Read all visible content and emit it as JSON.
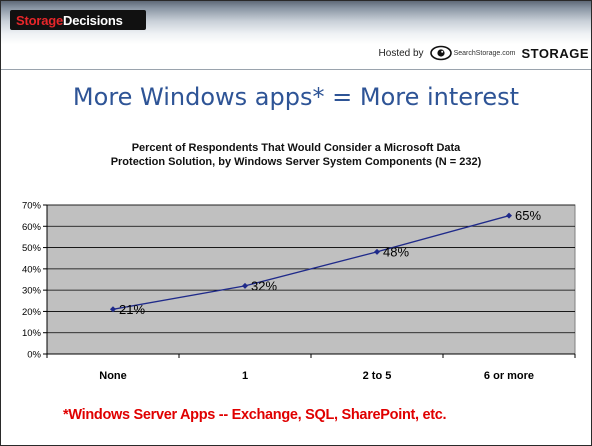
{
  "header": {
    "brand_part1": "Storage",
    "brand_part2": " Decisions",
    "hosted_by": "Hosted by",
    "site_logo_text": "SearchStorage.com",
    "storage_word": "STORAGE"
  },
  "slide": {
    "title": "More Windows apps* = More interest",
    "footnote": "*Windows Server Apps -- Exchange, SQL, SharePoint, etc."
  },
  "chart_data": {
    "type": "line",
    "title_line1": "Percent of Respondents That Would Consider a Microsoft Data",
    "title_line2": "Protection Solution, by Windows Server System Components (N = 232)",
    "categories": [
      "None",
      "1",
      "2 to 5",
      "6 or more"
    ],
    "values": [
      21,
      32,
      48,
      65
    ],
    "data_labels": [
      "21%",
      "32%",
      "48%",
      "65%"
    ],
    "yticks": [
      "0%",
      "10%",
      "20%",
      "30%",
      "40%",
      "50%",
      "60%",
      "70%"
    ],
    "ylim": [
      0,
      70
    ],
    "grid": true,
    "line_color": "#1f2a8a",
    "plot_background": "#c0c0c0"
  }
}
